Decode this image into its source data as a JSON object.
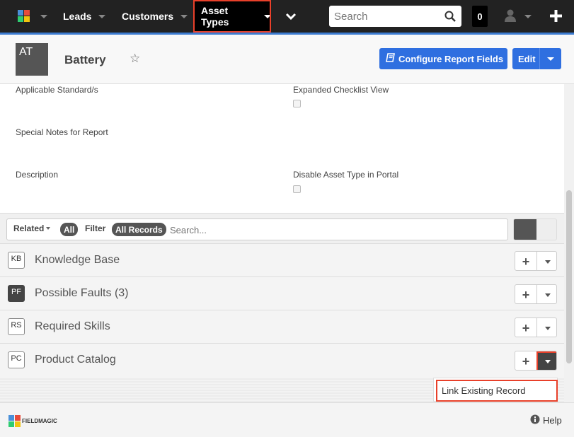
{
  "nav": {
    "items": [
      {
        "label": "Leads"
      },
      {
        "label": "Customers"
      },
      {
        "label": "Asset Types"
      }
    ],
    "search_placeholder": "Search",
    "notification_count": "0"
  },
  "header": {
    "avatar_text": "AT",
    "title": "Battery",
    "configure_label": "Configure Report Fields",
    "edit_label": "Edit"
  },
  "fields": {
    "applicable_standards": "Applicable Standard/s",
    "expanded_checklist": "Expanded Checklist View",
    "special_notes": "Special Notes for Report",
    "description": "Description",
    "disable_portal": "Disable Asset Type in Portal"
  },
  "filterbar": {
    "related_label": "Related",
    "all_label": "All",
    "filter_label": "Filter",
    "all_records_label": "All Records",
    "search_placeholder": "Search..."
  },
  "related_lists": [
    {
      "code": "KB",
      "name": "Knowledge Base"
    },
    {
      "code": "PF",
      "name": "Possible Faults (3)"
    },
    {
      "code": "RS",
      "name": "Required Skills"
    },
    {
      "code": "PC",
      "name": "Product Catalog"
    }
  ],
  "dropdown": {
    "link_existing": "Link Existing Record"
  },
  "footer": {
    "brand": "FIELDMAGIC",
    "help": "Help"
  }
}
